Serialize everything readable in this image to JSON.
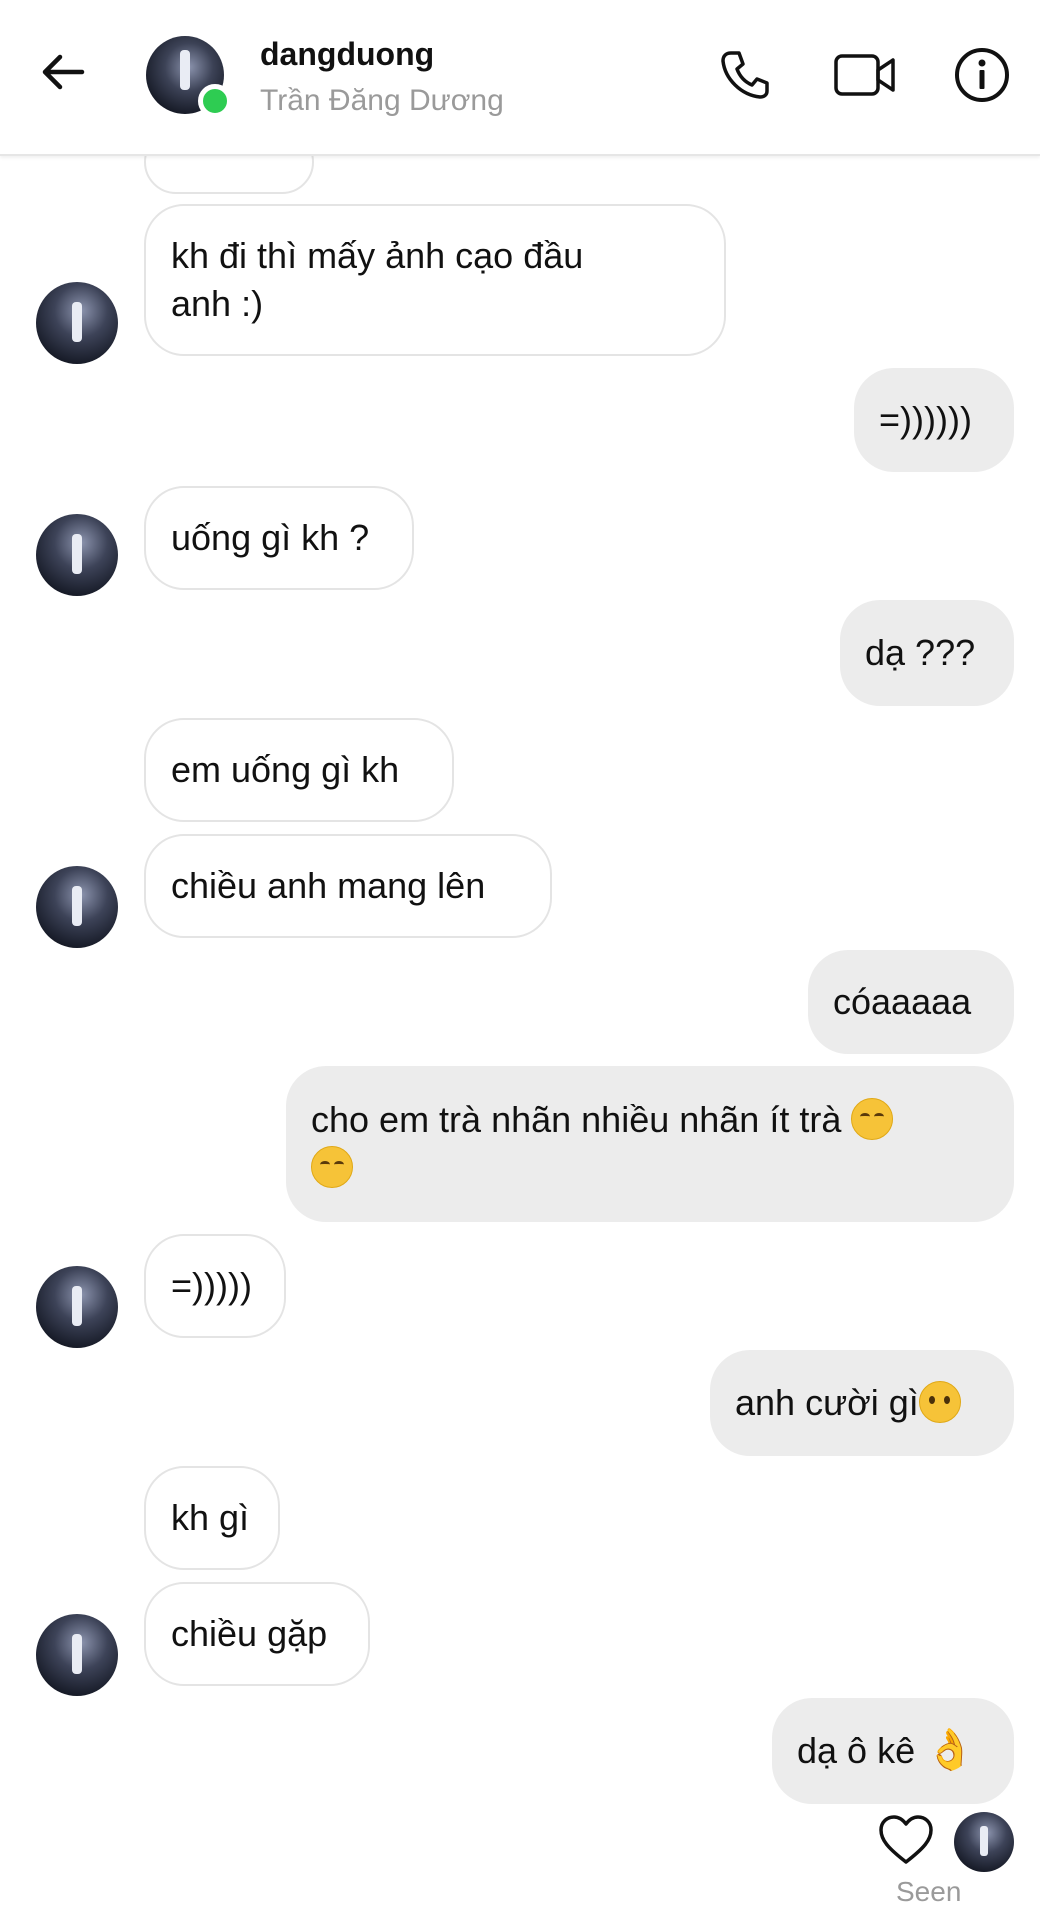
{
  "header": {
    "username": "dangduong",
    "display_name": "Trần Đăng Dương",
    "online_color": "#2ecc52",
    "icons": [
      "back-arrow-icon",
      "phone-icon",
      "video-camera-icon",
      "info-icon"
    ]
  },
  "messages": [
    {
      "id": "m1",
      "side": "in",
      "lines": [
        "kh đi thì mấy ảnh cạo đầu",
        "anh :)"
      ]
    },
    {
      "id": "m2",
      "side": "out",
      "lines": [
        "=))))))"
      ]
    },
    {
      "id": "m3",
      "side": "in",
      "lines": [
        "uống gì kh ?"
      ]
    },
    {
      "id": "m4",
      "side": "out",
      "lines": [
        "dạ ???"
      ]
    },
    {
      "id": "m5",
      "side": "in",
      "lines": [
        "em uống gì kh"
      ]
    },
    {
      "id": "m6",
      "side": "in",
      "lines": [
        "chiều anh mang lên"
      ]
    },
    {
      "id": "m7",
      "side": "out",
      "lines": [
        "cóaaaaa"
      ]
    },
    {
      "id": "m8",
      "side": "out",
      "lines": [
        "cho em trà nhãn nhiều nhãn ít trà",
        ""
      ],
      "emoji": "squinting-tongue-emoji"
    },
    {
      "id": "m9",
      "side": "in",
      "lines": [
        "=)))))"
      ]
    },
    {
      "id": "m10",
      "side": "out",
      "lines": [
        "anh cười gì"
      ],
      "emoji": "raised-eyebrow-emoji"
    },
    {
      "id": "m11",
      "side": "in",
      "lines": [
        "kh gì"
      ]
    },
    {
      "id": "m12",
      "side": "in",
      "lines": [
        "chiều gặp"
      ]
    },
    {
      "id": "m13",
      "side": "out",
      "lines": [
        "dạ ô kê"
      ],
      "emoji": "ok-hand-emoji"
    }
  ],
  "footer": {
    "seen_label": "Seen",
    "reaction_icon": "heart-outline-icon"
  },
  "colors": {
    "incoming_bubble_border": "#e4e4e4",
    "outgoing_bubble_bg": "#ececec",
    "muted_text": "#9a9a9a"
  }
}
